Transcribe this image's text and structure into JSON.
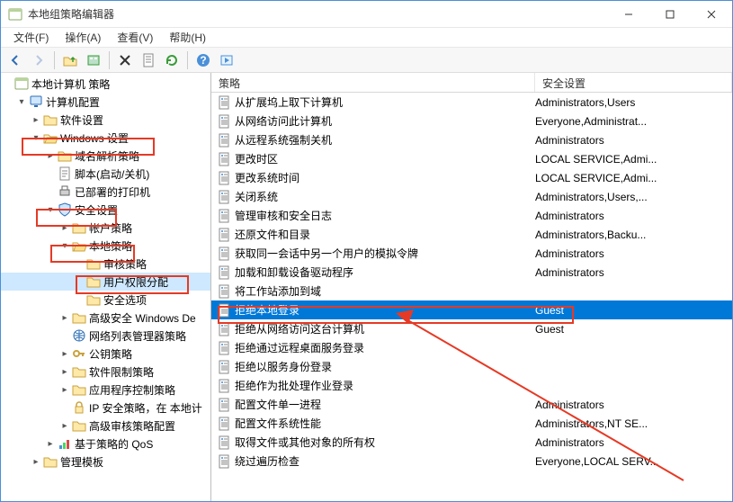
{
  "window": {
    "title": "本地组策略编辑器"
  },
  "menu": {
    "file": "文件(F)",
    "action": "操作(A)",
    "view": "查看(V)",
    "help": "帮助(H)"
  },
  "tree": {
    "root": "本地计算机 策略",
    "computer_config": "计算机配置",
    "software_settings": "软件设置",
    "windows_settings": "Windows 设置",
    "dns_policy": "域名解析策略",
    "scripts": "脚本(启动/关机)",
    "deployed_printers": "已部署的打印机",
    "security_settings": "安全设置",
    "account_policies": "帐户策略",
    "local_policies": "本地策略",
    "audit_policy": "审核策略",
    "user_rights": "用户权限分配",
    "security_options": "安全选项",
    "advanced_windows_defender": "高级安全 Windows De",
    "nlm_policies": "网络列表管理器策略",
    "public_key_policies": "公钥策略",
    "software_restriction": "软件限制策略",
    "app_control": "应用程序控制策略",
    "ip_security": "IP 安全策略，在 本地计",
    "advanced_audit": "高级审核策略配置",
    "qos": "基于策略的 QoS",
    "admin_templates": "管理模板"
  },
  "list": {
    "col1": "策略",
    "col2": "安全设置",
    "rows": [
      {
        "label": "从扩展坞上取下计算机",
        "value": "Administrators,Users"
      },
      {
        "label": "从网络访问此计算机",
        "value": "Everyone,Administrat..."
      },
      {
        "label": "从远程系统强制关机",
        "value": "Administrators"
      },
      {
        "label": "更改时区",
        "value": "LOCAL SERVICE,Admi..."
      },
      {
        "label": "更改系统时间",
        "value": "LOCAL SERVICE,Admi..."
      },
      {
        "label": "关闭系统",
        "value": "Administrators,Users,..."
      },
      {
        "label": "管理审核和安全日志",
        "value": "Administrators"
      },
      {
        "label": "还原文件和目录",
        "value": "Administrators,Backu..."
      },
      {
        "label": "获取同一会话中另一个用户的模拟令牌",
        "value": "Administrators"
      },
      {
        "label": "加载和卸载设备驱动程序",
        "value": "Administrators"
      },
      {
        "label": "将工作站添加到域",
        "value": ""
      },
      {
        "label": "拒绝本地登录",
        "value": "Guest",
        "selected": true
      },
      {
        "label": "拒绝从网络访问这台计算机",
        "value": "Guest"
      },
      {
        "label": "拒绝通过远程桌面服务登录",
        "value": ""
      },
      {
        "label": "拒绝以服务身份登录",
        "value": ""
      },
      {
        "label": "拒绝作为批处理作业登录",
        "value": ""
      },
      {
        "label": "配置文件单一进程",
        "value": "Administrators"
      },
      {
        "label": "配置文件系统性能",
        "value": "Administrators,NT SE..."
      },
      {
        "label": "取得文件或其他对象的所有权",
        "value": "Administrators"
      },
      {
        "label": "绕过遍历检查",
        "value": "Everyone,LOCAL SERV..."
      }
    ]
  }
}
